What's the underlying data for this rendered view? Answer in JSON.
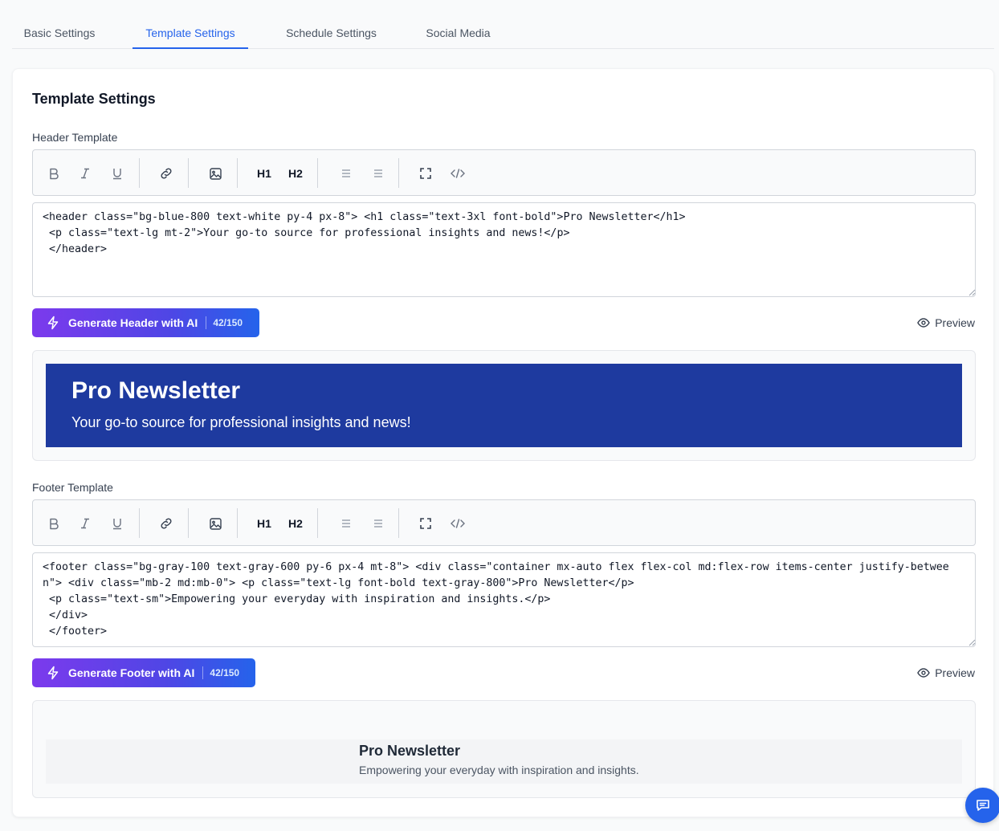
{
  "tabs": [
    {
      "label": "Basic Settings",
      "active": false
    },
    {
      "label": "Template Settings",
      "active": true
    },
    {
      "label": "Schedule Settings",
      "active": false
    },
    {
      "label": "Social Media",
      "active": false
    }
  ],
  "card": {
    "title": "Template Settings"
  },
  "toolbar": {
    "h1_label": "H1",
    "h2_label": "H2",
    "icons": [
      "bold-icon",
      "italic-icon",
      "underline-icon",
      "link-icon",
      "image-icon",
      "bullet-list-icon",
      "ordered-list-icon",
      "fullscreen-icon",
      "code-icon"
    ]
  },
  "header_template": {
    "label": "Header Template",
    "code": "<header class=\"bg-blue-800 text-white py-4 px-8\"> <h1 class=\"text-3xl font-bold\">Pro Newsletter</h1>\n <p class=\"text-lg mt-2\">Your go-to source for professional insights and news!</p>\n </header>",
    "ai_button_label": "Generate Header with AI",
    "ai_count": "42/150",
    "preview_label": "Preview",
    "preview": {
      "title": "Pro Newsletter",
      "subtitle": "Your go-to source for professional insights and news!"
    }
  },
  "footer_template": {
    "label": "Footer Template",
    "code": "<footer class=\"bg-gray-100 text-gray-600 py-6 px-4 mt-8\"> <div class=\"container mx-auto flex flex-col md:flex-row items-center justify-between\"> <div class=\"mb-2 md:mb-0\"> <p class=\"text-lg font-bold text-gray-800\">Pro Newsletter</p>\n <p class=\"text-sm\">Empowering your everyday with inspiration and insights.</p>\n </div>\n </footer>",
    "ai_button_label": "Generate Footer with AI",
    "ai_count": "42/150",
    "preview_label": "Preview",
    "preview": {
      "title": "Pro Newsletter",
      "subtitle": "Empowering your everyday with inspiration and insights."
    }
  },
  "colors": {
    "accent": "#2563eb",
    "header_banner": "#1e3a9f",
    "gradient_start": "#7c3aed",
    "gradient_end": "#2563eb"
  },
  "chat_button": {
    "icon": "chat-icon"
  }
}
